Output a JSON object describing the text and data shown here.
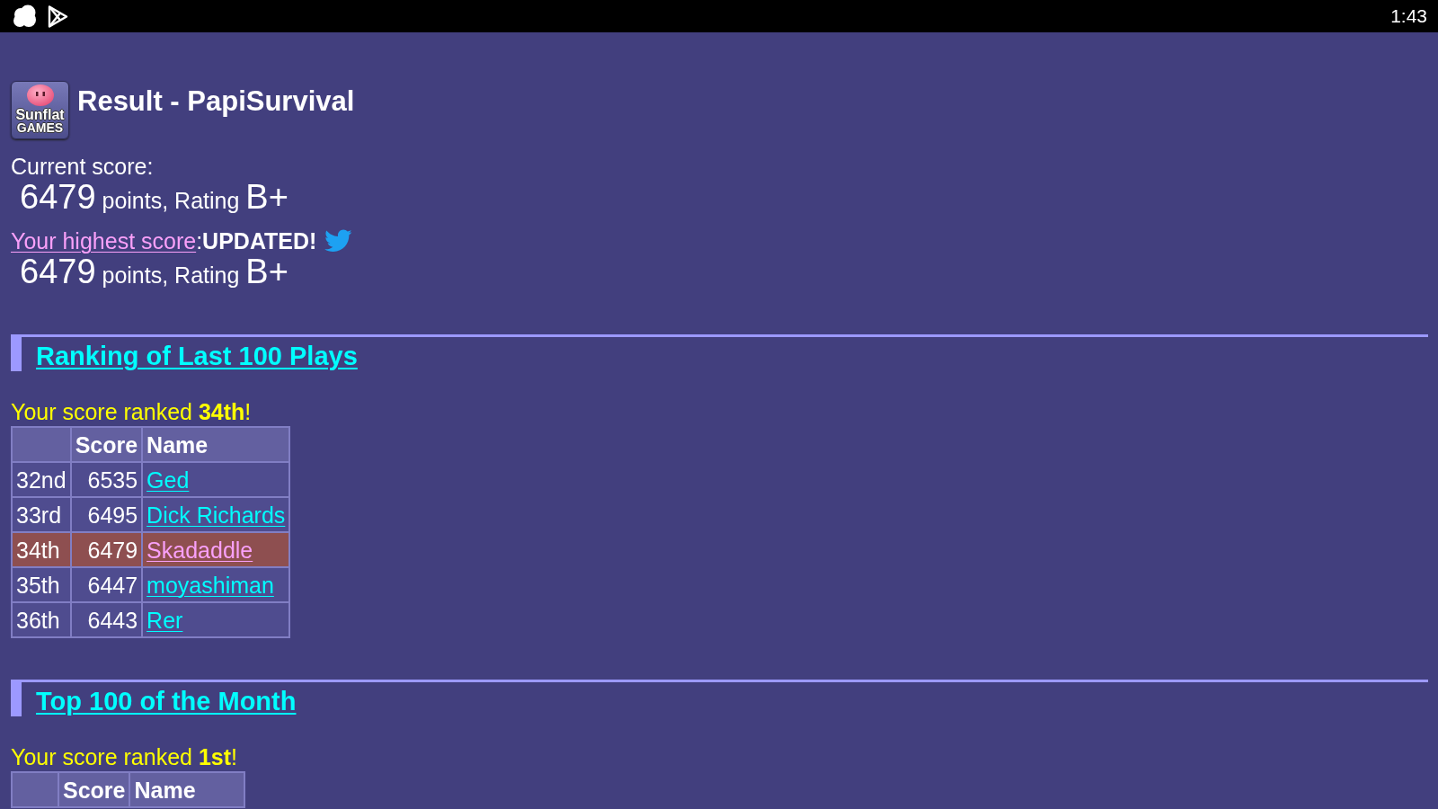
{
  "status_bar": {
    "time": "1:43"
  },
  "header": {
    "logo": {
      "line_1": "Sunflat",
      "line_2": "GAMES"
    },
    "title": "Result - PapiSurvival"
  },
  "current_score": {
    "label": "Current score:",
    "points": "6479",
    "unit": "points, Rating",
    "rating": "B+"
  },
  "highest_score": {
    "link": "Your highest score",
    "notice": ":**UPDATED!**",
    "points": "6479",
    "unit": "points, Rating",
    "rating": "B+"
  },
  "sections": [
    {
      "heading": "Ranking of Last 100 Plays",
      "message": "Your score ranked **34th**!",
      "table": {
        "columns": [
          "Score",
          "Name"
        ],
        "rows": [
          {
            "rank": "32nd",
            "score": "6535",
            "name": "Ged",
            "selected": false
          },
          {
            "rank": "33rd",
            "score": "6495",
            "name": "Dick Richards",
            "selected": false
          },
          {
            "rank": "34th",
            "score": "6479",
            "name": "Skadaddle",
            "selected": true
          },
          {
            "rank": "35th",
            "score": "6447",
            "name": "moyashiman",
            "selected": false
          },
          {
            "rank": "36th",
            "score": "6443",
            "name": "Rer",
            "selected": false
          }
        ]
      }
    },
    {
      "heading": "Top 100 of the Month",
      "message": "Your score ranked **1st**!",
      "table": {
        "columns": [
          "Score",
          "Name"
        ]
      }
    }
  ]
}
